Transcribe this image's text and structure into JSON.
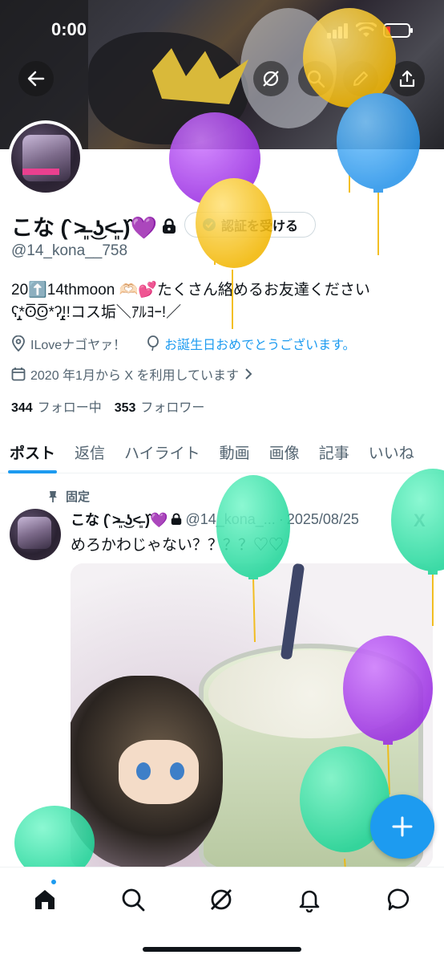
{
  "status_bar": {
    "time": "0:00"
  },
  "profile": {
    "name": "こな (̂ ˃̶͈ ͜ʖ˂̶͈ )̂💜",
    "verify_label": "認証を受ける",
    "handle": "@14_kona__758",
    "bio_line1": "20⬆️14thmoon 🫶🏻💕たくさん絡めるお友達ください",
    "bio_line2": "ʕ̡̢̡*ʘ̅͜ʘ̅*ʔ̢̡̢!!コス垢＼ｱﾙﾖｰ!／",
    "location": "ILoveナゴヤァ！",
    "birthday_link": "お誕生日おめでとうございます。",
    "joined": "2020 年1月から X を利用しています",
    "following_count": "344",
    "following_label": "フォロー中",
    "followers_count": "353",
    "followers_label": "フォロワー"
  },
  "tabs": [
    "ポスト",
    "返信",
    "ハイライト",
    "動画",
    "画像",
    "記事",
    "いいね"
  ],
  "post": {
    "pinned_label": "固定",
    "author_name": "こな (̂ ˃̶͈ ͜ʖ˂̶͈ )̂💜",
    "author_handle": "@14_kona_...",
    "separator": "·",
    "date": "2025/08/25",
    "x_mark": "X",
    "text": "めろかわじゃない？？？？♡♡"
  },
  "icons": {
    "back": "arrow-left-icon",
    "grok": "grok-icon",
    "search": "search-icon",
    "edit": "pencil-icon",
    "share": "share-icon",
    "lock": "lock-icon",
    "location": "location-pin-icon",
    "balloon": "balloon-icon",
    "calendar": "calendar-icon",
    "chevron": "chevron-right-icon",
    "pin": "pin-icon",
    "compose": "plus-icon",
    "nav": [
      "home-icon",
      "search-icon",
      "grok-icon",
      "bell-icon",
      "message-icon"
    ]
  },
  "colors": {
    "accent": "#1d9bf0",
    "text": "#0f1419",
    "secondary": "#536471",
    "balloon_yellow": "#f5c518",
    "balloon_purple": "#a33ee8",
    "balloon_blue": "#3aa7f0",
    "balloon_green": "#34e3a8"
  }
}
